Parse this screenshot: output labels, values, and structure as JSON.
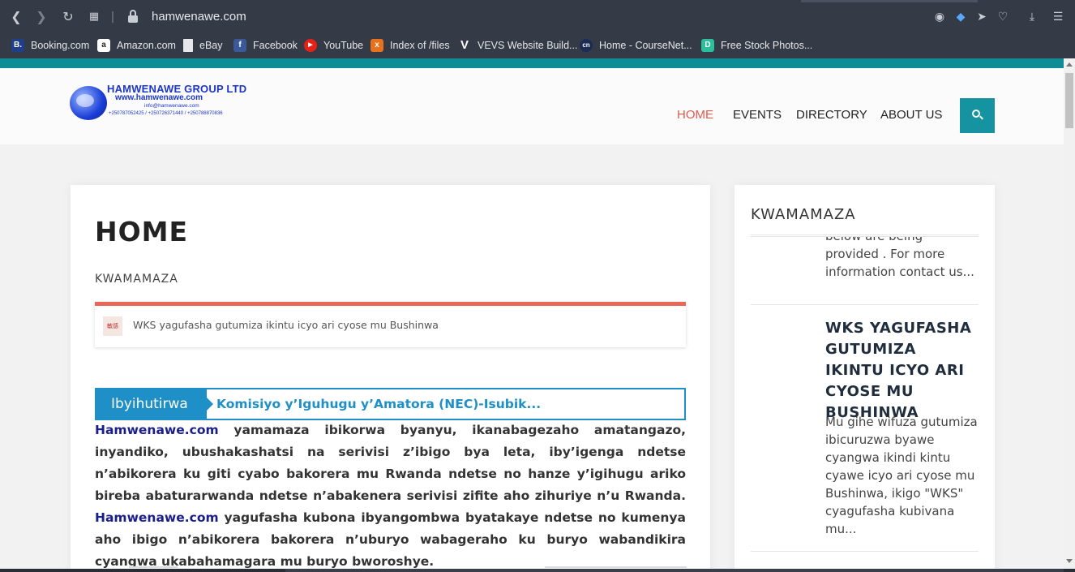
{
  "browser": {
    "url": "hamwenawe.com",
    "bookmarks": [
      {
        "label": "Booking.com",
        "icon": "booking-icon",
        "color": "#1e3f8a",
        "glyph": "B."
      },
      {
        "label": "Amazon.com",
        "icon": "amazon-icon",
        "color": "#ffffff",
        "glyph": "a"
      },
      {
        "label": "eBay",
        "icon": "document-icon",
        "color": "#e6e7ea",
        "glyph": ""
      },
      {
        "label": "Facebook",
        "icon": "facebook-icon",
        "color": "#3b5998",
        "glyph": "f"
      },
      {
        "label": "YouTube",
        "icon": "youtube-icon",
        "color": "#e62117",
        "glyph": "▶"
      },
      {
        "label": "Index of /files",
        "icon": "xampp-icon",
        "color": "#e8711c",
        "glyph": "x"
      },
      {
        "label": "VEVS Website Build...",
        "icon": "vevs-icon",
        "color": "#343a46",
        "glyph": "V"
      },
      {
        "label": "Home - CourseNet...",
        "icon": "coursenet-icon",
        "color": "#1c2b55",
        "glyph": "cn"
      },
      {
        "label": "Free Stock Photos...",
        "icon": "stockphotos-icon",
        "color": "#2bbf9b",
        "glyph": "D"
      }
    ]
  },
  "site": {
    "logo": {
      "title": "HAMWENAWE GROUP LTD",
      "url": "www.hamwenawe.com",
      "email": "info@hamwenawe.com",
      "phones": "+250787052425 / +250726371440 / +250788870836"
    },
    "nav": [
      "HOME",
      "EVENTS",
      "DIRECTORY",
      "ABOUT US"
    ],
    "active_nav": "HOME",
    "accent_color": "#1593a0",
    "active_color": "#e05a4c"
  },
  "main": {
    "title": "HOME",
    "section_label": "KWAMAMAZA",
    "ticker_text": "WKS yagufasha gutumiza ikintu icyo ari cyose mu Bushinwa",
    "ticker_thumb_text": "敏感",
    "headline_tag": "Ibyihutirwa",
    "headline_text": "Komisiyo y’Iguhugu y’Amatora (NEC)-Isubik...",
    "body": {
      "brand": "Hamwenawe.com",
      "part1": " yamamaza ibikorwa byanyu, ikanabagezaho amatangazo, inyandiko, ubushakashatsi na serivisi z’ibigo bya leta, iby’igenga ndetse n’abikorera ku giti cyabo bakorera mu Rwanda ndetse no hanze y’igihugu ariko bireba abaturarwanda ndetse n’abakenera serivisi zifite aho zihuriye n’u Rwanda. ",
      "brand2": "Hamwenawe.com",
      "part2": " yagufasha kubona ibyangombwa byatakaye ndetse no kumenya aho ibigo n’abikorera bakorera n’uburyo wabageraho ku buryo wabandikira cyangwa ukabahamagara mu buryo bworoshye."
    }
  },
  "sidebar": {
    "title": "KWAMAMAZA",
    "item1_text": "below are being provided . For more information contact us...",
    "item2_title": "WKS YAGUFASHA GUTUMIZA IKINTU ICYO ARI CYOSE MU BUSHINWA",
    "item2_text": "Mu gihe wifuza gutumiza ibicuruzwa byawe cyangwa ikindi kintu cyawe icyo ari cyose mu Bushinwa, ikigo \"WKS\" cyagufasha kubivana mu..."
  }
}
